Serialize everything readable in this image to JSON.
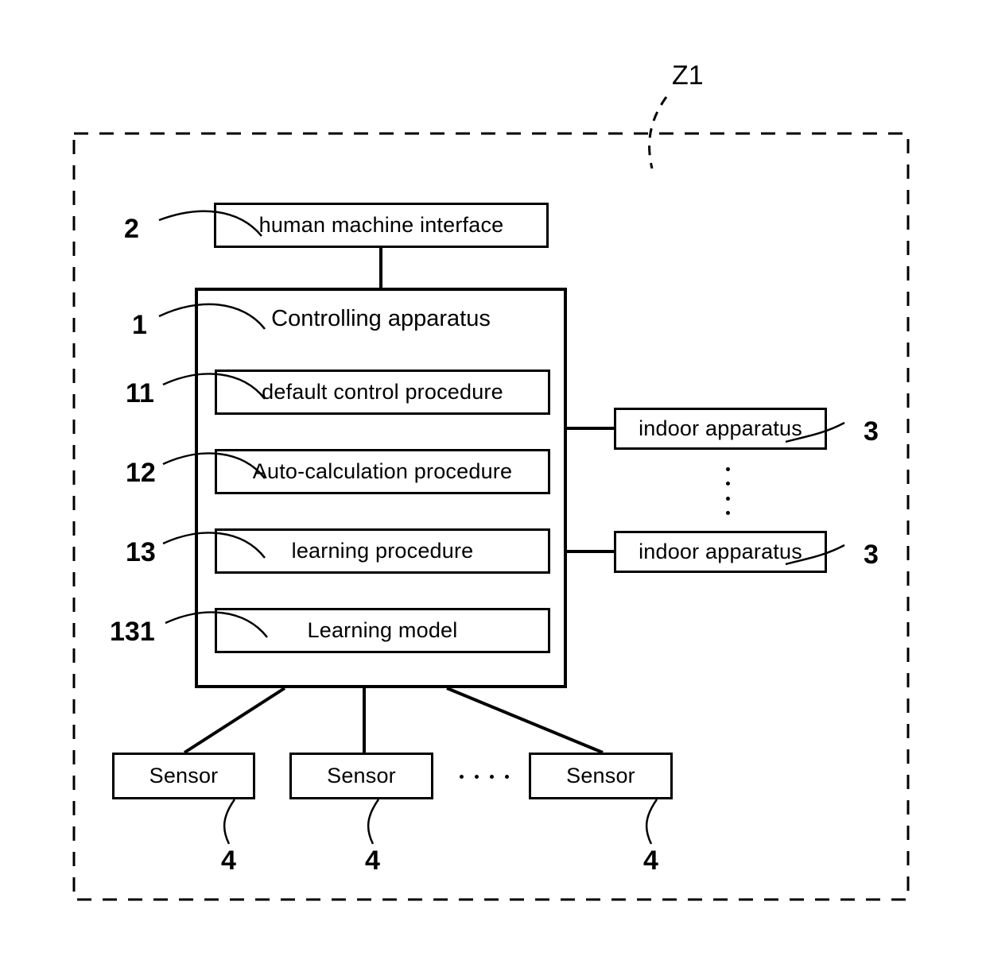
{
  "system": {
    "boundary_label": "Z1",
    "boundary_style": "dashed"
  },
  "blocks": {
    "hmi": {
      "label": "human machine interface",
      "ref": "2"
    },
    "controller": {
      "label": "Controlling apparatus",
      "ref": "1"
    },
    "default_control": {
      "label": "default control procedure",
      "ref": "11"
    },
    "auto_calculation": {
      "label": "Auto-calculation procedure",
      "ref": "12"
    },
    "learning_procedure": {
      "label": "learning procedure",
      "ref": "13"
    },
    "learning_model": {
      "label": "Learning model",
      "ref": "131"
    }
  },
  "indoor_apparatus": [
    {
      "label": "indoor apparatus",
      "ref": "3"
    },
    {
      "label": "indoor apparatus",
      "ref": "3"
    }
  ],
  "sensors": [
    {
      "label": "Sensor",
      "ref": "4"
    },
    {
      "label": "Sensor",
      "ref": "4"
    },
    {
      "label": "Sensor",
      "ref": "4"
    }
  ],
  "ellipsis": {
    "vertical_indoor": "⋮",
    "horizontal_sensor": "...."
  },
  "colors": {
    "line": "#000000",
    "background": "#ffffff"
  }
}
